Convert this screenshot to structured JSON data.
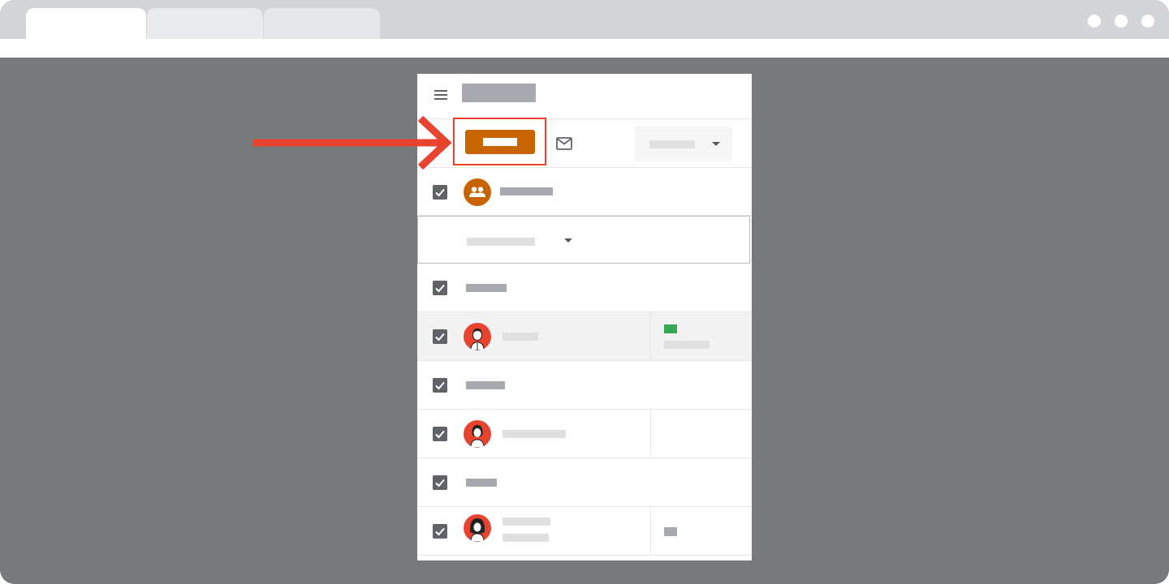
{
  "browser": {
    "tabs": [
      {
        "label": "",
        "active": true
      },
      {
        "label": "",
        "active": false
      },
      {
        "label": "",
        "active": false
      }
    ],
    "window_controls": [
      "dot",
      "dot",
      "dot"
    ]
  },
  "app": {
    "header": {
      "title": ""
    },
    "toolbar": {
      "primary_button_label": "",
      "mail_icon": "mail-icon",
      "dropdown_value": ""
    },
    "group_row": {
      "label": ""
    },
    "filter": {
      "value": ""
    },
    "rows": [
      {
        "type": "section",
        "label": "",
        "checked": true
      },
      {
        "type": "person",
        "name": "",
        "detail_badge": "green",
        "detail_text": "",
        "highlighted": true,
        "checked": true
      },
      {
        "type": "section",
        "label": "",
        "checked": true
      },
      {
        "type": "person",
        "name": "",
        "detail_badge": "",
        "detail_text": "",
        "highlighted": false,
        "checked": true
      },
      {
        "type": "section",
        "label": "",
        "checked": true
      },
      {
        "type": "person",
        "name": "",
        "subtext": "",
        "detail_badge": "gray",
        "highlighted": false,
        "checked": true
      }
    ]
  },
  "annotation": {
    "arrow_color": "#e8432f",
    "highlight_color": "#e8432f",
    "target": "primary-button"
  },
  "colors": {
    "accent": "#c86400",
    "avatar_bg": "#e8432f",
    "success": "#34a853",
    "backdrop": "#777a7c"
  }
}
